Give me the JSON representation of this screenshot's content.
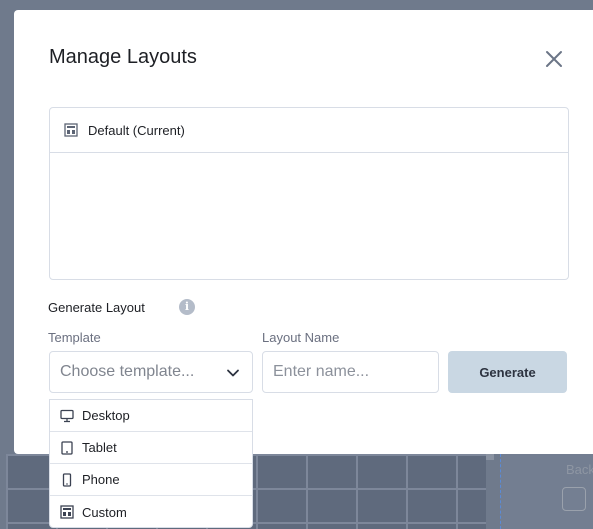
{
  "modal": {
    "title": "Manage Layouts",
    "close_icon": "close-icon"
  },
  "layouts": [
    {
      "label": "Default (Current)",
      "icon": "layout-grid-icon"
    }
  ],
  "generate": {
    "section_label": "Generate Layout",
    "info_icon": "info-icon",
    "template_label": "Template",
    "template_placeholder": "Choose template...",
    "name_label": "Layout Name",
    "name_placeholder": "Enter name...",
    "button_label": "Generate"
  },
  "template_options": [
    {
      "label": "Desktop",
      "icon": "desktop-icon"
    },
    {
      "label": "Tablet",
      "icon": "tablet-icon"
    },
    {
      "label": "Phone",
      "icon": "phone-icon"
    },
    {
      "label": "Custom",
      "icon": "layout-grid-icon"
    }
  ],
  "background": {
    "partial_label": "Back"
  },
  "colors": {
    "generate_button": "#c9d7e3",
    "border": "#d8dde6",
    "overlay": "#6f7a8c"
  }
}
